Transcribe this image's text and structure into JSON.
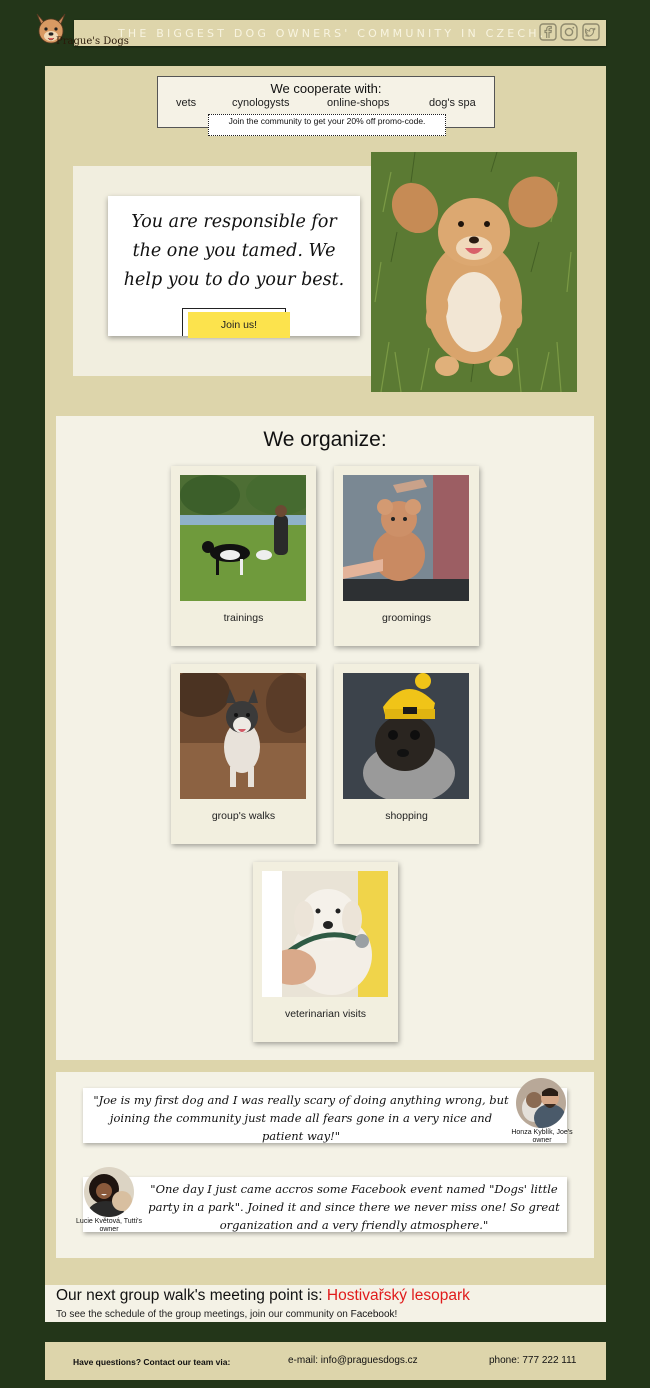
{
  "header": {
    "logo_text": "Prague's Dogs",
    "tagline": "The biggest dog owners' community in Czech.",
    "social": [
      "facebook-icon",
      "instagram-icon",
      "twitter-icon"
    ]
  },
  "cooperation": {
    "title": "We cooperate with:",
    "links": [
      "vets",
      "cynologysts",
      "online-shops",
      "dog's spa"
    ],
    "promo": "Join the community to get your 20% off promo-code."
  },
  "hero": {
    "quote": "You are responsible for the one you tamed. We help you to do your best.",
    "button": "Join us!"
  },
  "organize": {
    "title": "We organize:",
    "services": [
      {
        "label": "trainings"
      },
      {
        "label": "groomings"
      },
      {
        "label": "group's walks"
      },
      {
        "label": "shopping"
      },
      {
        "label": "veterinarian visits"
      }
    ]
  },
  "testimonials": [
    {
      "quote": "\"Joe is my first dog and I was really scary of doing anything wrong, but joining the community just made all fears gone in a very nice and patient way!\"",
      "author": "Honza Kyblík, Joe's owner"
    },
    {
      "quote": "\"One day I just came accros some Facebook event named \"Dogs' little party in a park\". Joined it and since there we never miss one! So great organization and a very friendly atmosphere.\"",
      "author": "Lucie Květová, Tutti's owner"
    }
  ],
  "meeting": {
    "prefix": "Our next group walk's meeting point is: ",
    "place": "Hostivařský lesopark",
    "sub_prefix": "To see the schedule of the group meetings, join our community on ",
    "sub_link": "Facebook",
    "sub_suffix": "!"
  },
  "footer": {
    "contact": "Have questions? Contact our team via:",
    "email": "e-mail: info@praguesdogs.cz",
    "phone": "phone: 777 222 111"
  },
  "colors": {
    "background": "#233619",
    "panel": "#ddd5ab",
    "card": "#f4f2e6",
    "button": "#fce34d",
    "highlight": "#e01b1b"
  }
}
